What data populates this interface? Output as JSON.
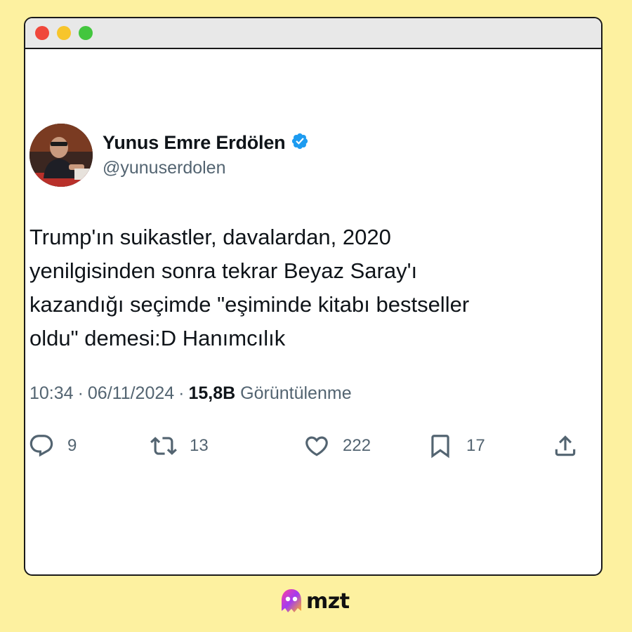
{
  "author": {
    "name": "Yunus Emre Erdölen",
    "handle": "@yunuserdolen",
    "verified": true,
    "verified_color": "#1d9bf0"
  },
  "tweet": {
    "text": "Trump'ın suikastler, davalardan, 2020\nyenilgisinden sonra tekrar Beyaz Saray'ı\nkazandığı seçimde \"eşiminde kitabı bestseller\noldu\" demesi:D Hanımcılık",
    "time": "10:34",
    "separator": "·",
    "date": "06/11/2024",
    "views_count": "15,8B",
    "views_label": "Görüntülenme"
  },
  "actions": {
    "replies": "9",
    "retweets": "13",
    "likes": "222",
    "bookmarks": "17"
  },
  "brand": {
    "logo_text": "mzt",
    "background": "#fdf1a0"
  }
}
